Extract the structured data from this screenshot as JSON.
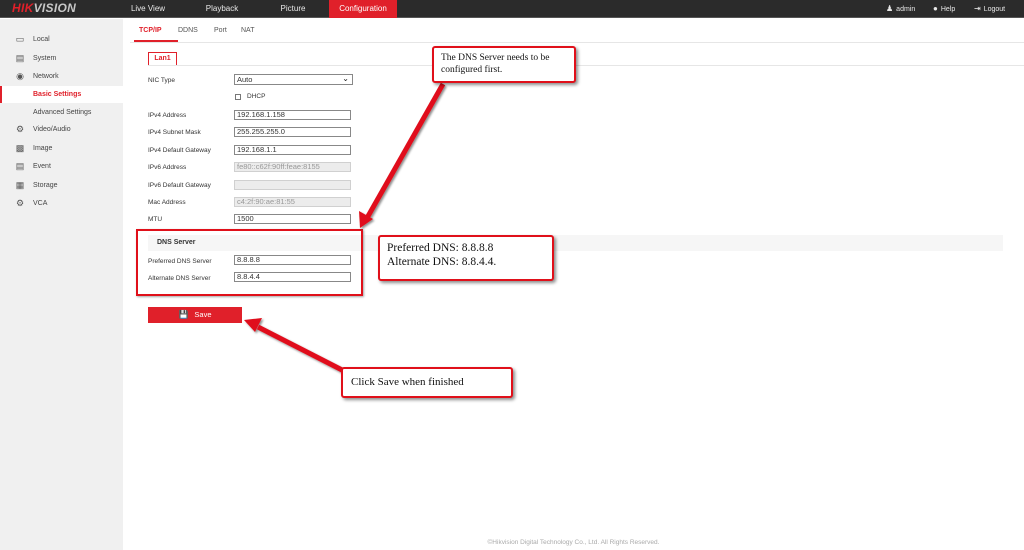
{
  "header": {
    "logo_prefix": "HIK",
    "logo_suffix": "VISION",
    "nav_tabs": [
      {
        "label": "Live View",
        "active": false
      },
      {
        "label": "Playback",
        "active": false
      },
      {
        "label": "Picture",
        "active": false
      },
      {
        "label": "Configuration",
        "active": true
      }
    ],
    "user": {
      "icon": "user-icon",
      "label": "admin"
    },
    "help": {
      "icon": "help-icon",
      "label": "Help"
    },
    "logout": {
      "icon": "logout-icon",
      "label": "Logout"
    }
  },
  "sidebar": {
    "items": [
      {
        "icon": "monitor-icon",
        "label": "Local"
      },
      {
        "icon": "system-icon",
        "label": "System"
      },
      {
        "icon": "globe-icon",
        "label": "Network"
      },
      {
        "icon": "video-audio-icon",
        "label": "Video/Audio"
      },
      {
        "icon": "image-icon",
        "label": "Image"
      },
      {
        "icon": "event-icon",
        "label": "Event"
      },
      {
        "icon": "storage-icon",
        "label": "Storage"
      },
      {
        "icon": "vca-icon",
        "label": "VCA"
      }
    ],
    "network_sub": [
      {
        "label": "Basic Settings",
        "active": true
      },
      {
        "label": "Advanced Settings",
        "active": false
      }
    ]
  },
  "subtabs": [
    {
      "label": "TCP/IP",
      "active": true
    },
    {
      "label": "DDNS",
      "active": false
    },
    {
      "label": "Port",
      "active": false
    },
    {
      "label": "NAT",
      "active": false
    }
  ],
  "lan_tab": "Lan1",
  "form": {
    "nic_type": {
      "label": "NIC Type",
      "value": "Auto"
    },
    "dhcp": {
      "label": "DHCP",
      "checked": false
    },
    "ipv4_address": {
      "label": "IPv4 Address",
      "value": "192.168.1.158"
    },
    "ipv4_subnet": {
      "label": "IPv4 Subnet Mask",
      "value": "255.255.255.0"
    },
    "ipv4_gateway": {
      "label": "IPv4 Default Gateway",
      "value": "192.168.1.1"
    },
    "ipv6_address": {
      "label": "IPv6 Address",
      "value": "fe80::c62f:90ff:feae:8155"
    },
    "ipv6_gateway": {
      "label": "IPv6 Default Gateway",
      "value": ""
    },
    "mac_address": {
      "label": "Mac Address",
      "value": "c4:2f:90:ae:81:55"
    },
    "mtu": {
      "label": "MTU",
      "value": "1500"
    },
    "dns_section_title": "DNS Server",
    "preferred_dns": {
      "label": "Preferred DNS Server",
      "value": "8.8.8.8"
    },
    "alternate_dns": {
      "label": "Alternate DNS Server",
      "value": "8.8.4.4"
    },
    "save_label": "Save"
  },
  "annotations": {
    "dns_note": "The DNS Server needs to be configured first.",
    "values_line1": "Preferred DNS: 8.8.8.8",
    "values_line2": "Alternate DNS: 8.8.4.4.",
    "save_note": "Click Save when finished"
  },
  "colors": {
    "accent": "#e0202a",
    "annotation_red": "#e0101a",
    "topbar": "#2b2b2b",
    "sidebar": "#f0f0f0"
  },
  "footer": "©Hikvision Digital Technology Co., Ltd. All Rights Reserved."
}
